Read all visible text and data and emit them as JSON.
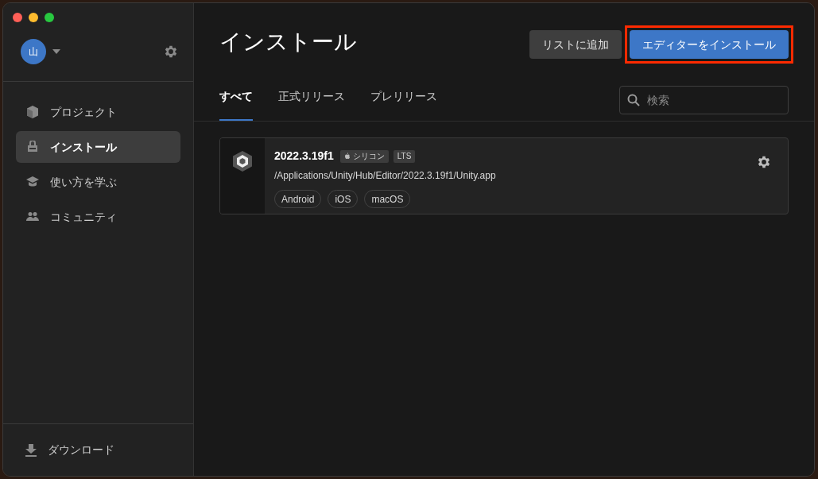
{
  "user": {
    "initial": "山"
  },
  "sidebar": {
    "items": [
      {
        "kind": "projects",
        "label": "プロジェクト",
        "selected": false
      },
      {
        "kind": "installs",
        "label": "インストール",
        "selected": true
      },
      {
        "kind": "learn",
        "label": "使い方を学ぶ",
        "selected": false
      },
      {
        "kind": "community",
        "label": "コミュニティ",
        "selected": false
      }
    ],
    "footer": {
      "label": "ダウンロード"
    }
  },
  "title": "インストール",
  "buttons": [
    {
      "kind": "secondary",
      "label": "リストに追加",
      "highlighted": false
    },
    {
      "kind": "primary",
      "label": "エディターをインストール",
      "highlighted": true
    }
  ],
  "tabs": [
    {
      "label": "すべて",
      "selected": true
    },
    {
      "label": "正式リリース",
      "selected": false
    },
    {
      "label": "プレリリース",
      "selected": false
    }
  ],
  "search": {
    "placeholder": "検索"
  },
  "installs": [
    {
      "version": "2022.3.19f1",
      "badges": [
        {
          "kind": "apple",
          "label": "シリコン"
        },
        {
          "kind": "plain",
          "label": "LTS"
        }
      ],
      "path": "/Applications/Unity/Hub/Editor/2022.3.19f1/Unity.app",
      "modules": [
        "Android",
        "iOS",
        "macOS"
      ]
    }
  ]
}
